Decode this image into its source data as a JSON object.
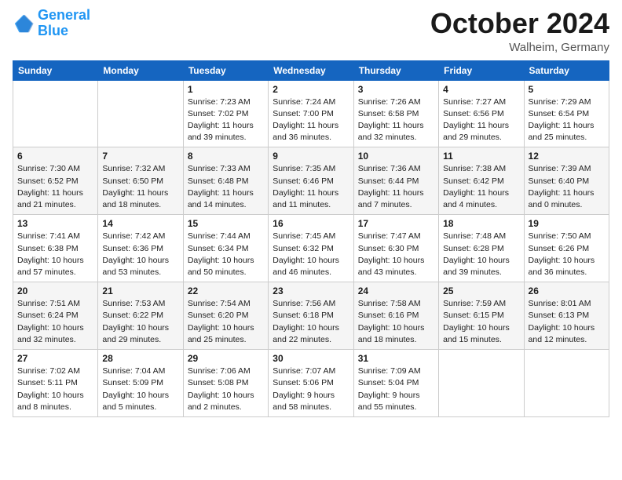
{
  "header": {
    "logo_line1": "General",
    "logo_line2": "Blue",
    "month_title": "October 2024",
    "location": "Walheim, Germany"
  },
  "weekdays": [
    "Sunday",
    "Monday",
    "Tuesday",
    "Wednesday",
    "Thursday",
    "Friday",
    "Saturday"
  ],
  "weeks": [
    [
      {
        "day": "",
        "info": ""
      },
      {
        "day": "",
        "info": ""
      },
      {
        "day": "1",
        "info": "Sunrise: 7:23 AM\nSunset: 7:02 PM\nDaylight: 11 hours and 39 minutes."
      },
      {
        "day": "2",
        "info": "Sunrise: 7:24 AM\nSunset: 7:00 PM\nDaylight: 11 hours and 36 minutes."
      },
      {
        "day": "3",
        "info": "Sunrise: 7:26 AM\nSunset: 6:58 PM\nDaylight: 11 hours and 32 minutes."
      },
      {
        "day": "4",
        "info": "Sunrise: 7:27 AM\nSunset: 6:56 PM\nDaylight: 11 hours and 29 minutes."
      },
      {
        "day": "5",
        "info": "Sunrise: 7:29 AM\nSunset: 6:54 PM\nDaylight: 11 hours and 25 minutes."
      }
    ],
    [
      {
        "day": "6",
        "info": "Sunrise: 7:30 AM\nSunset: 6:52 PM\nDaylight: 11 hours and 21 minutes."
      },
      {
        "day": "7",
        "info": "Sunrise: 7:32 AM\nSunset: 6:50 PM\nDaylight: 11 hours and 18 minutes."
      },
      {
        "day": "8",
        "info": "Sunrise: 7:33 AM\nSunset: 6:48 PM\nDaylight: 11 hours and 14 minutes."
      },
      {
        "day": "9",
        "info": "Sunrise: 7:35 AM\nSunset: 6:46 PM\nDaylight: 11 hours and 11 minutes."
      },
      {
        "day": "10",
        "info": "Sunrise: 7:36 AM\nSunset: 6:44 PM\nDaylight: 11 hours and 7 minutes."
      },
      {
        "day": "11",
        "info": "Sunrise: 7:38 AM\nSunset: 6:42 PM\nDaylight: 11 hours and 4 minutes."
      },
      {
        "day": "12",
        "info": "Sunrise: 7:39 AM\nSunset: 6:40 PM\nDaylight: 11 hours and 0 minutes."
      }
    ],
    [
      {
        "day": "13",
        "info": "Sunrise: 7:41 AM\nSunset: 6:38 PM\nDaylight: 10 hours and 57 minutes."
      },
      {
        "day": "14",
        "info": "Sunrise: 7:42 AM\nSunset: 6:36 PM\nDaylight: 10 hours and 53 minutes."
      },
      {
        "day": "15",
        "info": "Sunrise: 7:44 AM\nSunset: 6:34 PM\nDaylight: 10 hours and 50 minutes."
      },
      {
        "day": "16",
        "info": "Sunrise: 7:45 AM\nSunset: 6:32 PM\nDaylight: 10 hours and 46 minutes."
      },
      {
        "day": "17",
        "info": "Sunrise: 7:47 AM\nSunset: 6:30 PM\nDaylight: 10 hours and 43 minutes."
      },
      {
        "day": "18",
        "info": "Sunrise: 7:48 AM\nSunset: 6:28 PM\nDaylight: 10 hours and 39 minutes."
      },
      {
        "day": "19",
        "info": "Sunrise: 7:50 AM\nSunset: 6:26 PM\nDaylight: 10 hours and 36 minutes."
      }
    ],
    [
      {
        "day": "20",
        "info": "Sunrise: 7:51 AM\nSunset: 6:24 PM\nDaylight: 10 hours and 32 minutes."
      },
      {
        "day": "21",
        "info": "Sunrise: 7:53 AM\nSunset: 6:22 PM\nDaylight: 10 hours and 29 minutes."
      },
      {
        "day": "22",
        "info": "Sunrise: 7:54 AM\nSunset: 6:20 PM\nDaylight: 10 hours and 25 minutes."
      },
      {
        "day": "23",
        "info": "Sunrise: 7:56 AM\nSunset: 6:18 PM\nDaylight: 10 hours and 22 minutes."
      },
      {
        "day": "24",
        "info": "Sunrise: 7:58 AM\nSunset: 6:16 PM\nDaylight: 10 hours and 18 minutes."
      },
      {
        "day": "25",
        "info": "Sunrise: 7:59 AM\nSunset: 6:15 PM\nDaylight: 10 hours and 15 minutes."
      },
      {
        "day": "26",
        "info": "Sunrise: 8:01 AM\nSunset: 6:13 PM\nDaylight: 10 hours and 12 minutes."
      }
    ],
    [
      {
        "day": "27",
        "info": "Sunrise: 7:02 AM\nSunset: 5:11 PM\nDaylight: 10 hours and 8 minutes."
      },
      {
        "day": "28",
        "info": "Sunrise: 7:04 AM\nSunset: 5:09 PM\nDaylight: 10 hours and 5 minutes."
      },
      {
        "day": "29",
        "info": "Sunrise: 7:06 AM\nSunset: 5:08 PM\nDaylight: 10 hours and 2 minutes."
      },
      {
        "day": "30",
        "info": "Sunrise: 7:07 AM\nSunset: 5:06 PM\nDaylight: 9 hours and 58 minutes."
      },
      {
        "day": "31",
        "info": "Sunrise: 7:09 AM\nSunset: 5:04 PM\nDaylight: 9 hours and 55 minutes."
      },
      {
        "day": "",
        "info": ""
      },
      {
        "day": "",
        "info": ""
      }
    ]
  ]
}
